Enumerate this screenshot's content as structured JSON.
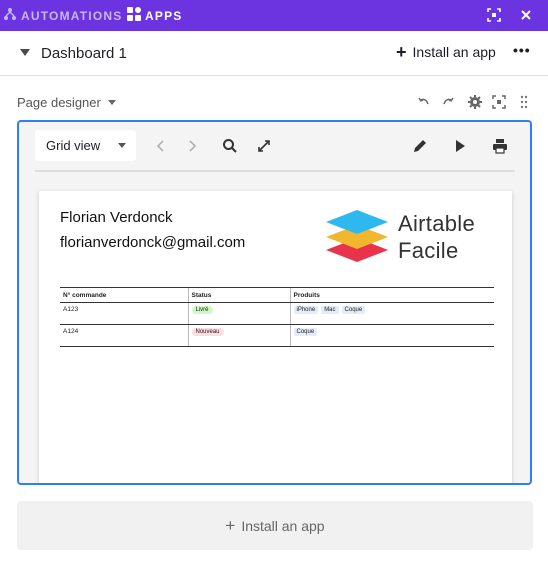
{
  "topbar": {
    "automations_label": "AUTOMATIONS",
    "apps_label": "APPS",
    "bg_color": "#6c33e1",
    "icons": [
      "expand-icon",
      "close-icon"
    ]
  },
  "dashboard": {
    "title": "Dashboard 1",
    "install_label": "Install an app",
    "more_label": "•••"
  },
  "designer": {
    "label": "Page designer",
    "view_select": "Grid view",
    "tools": [
      "undo-icon",
      "redo-icon",
      "settings-icon",
      "expand-icon",
      "drag-handle-icon"
    ],
    "toolbar_icons": [
      "chevron-left-icon",
      "chevron-right-icon",
      "search-icon",
      "expand-icon",
      "pencil-icon",
      "play-icon",
      "print-icon"
    ]
  },
  "page": {
    "name": "Florian Verdonck",
    "email": "florianverdonck@gmail.com",
    "brand_line1": "Airtable",
    "brand_line2": "Facile",
    "table": {
      "headers": [
        "N° commande",
        "Status",
        "Produits"
      ],
      "rows": [
        {
          "order": "A123",
          "status": "Livré",
          "status_color": "#d1f7c4",
          "products": [
            "iPhone",
            "Mac",
            "Coque"
          ]
        },
        {
          "order": "A124",
          "status": "Nouveau",
          "status_color": "#ffdce5",
          "products": [
            "Coque"
          ]
        }
      ]
    }
  },
  "footer": {
    "install_label": "Install an app"
  }
}
